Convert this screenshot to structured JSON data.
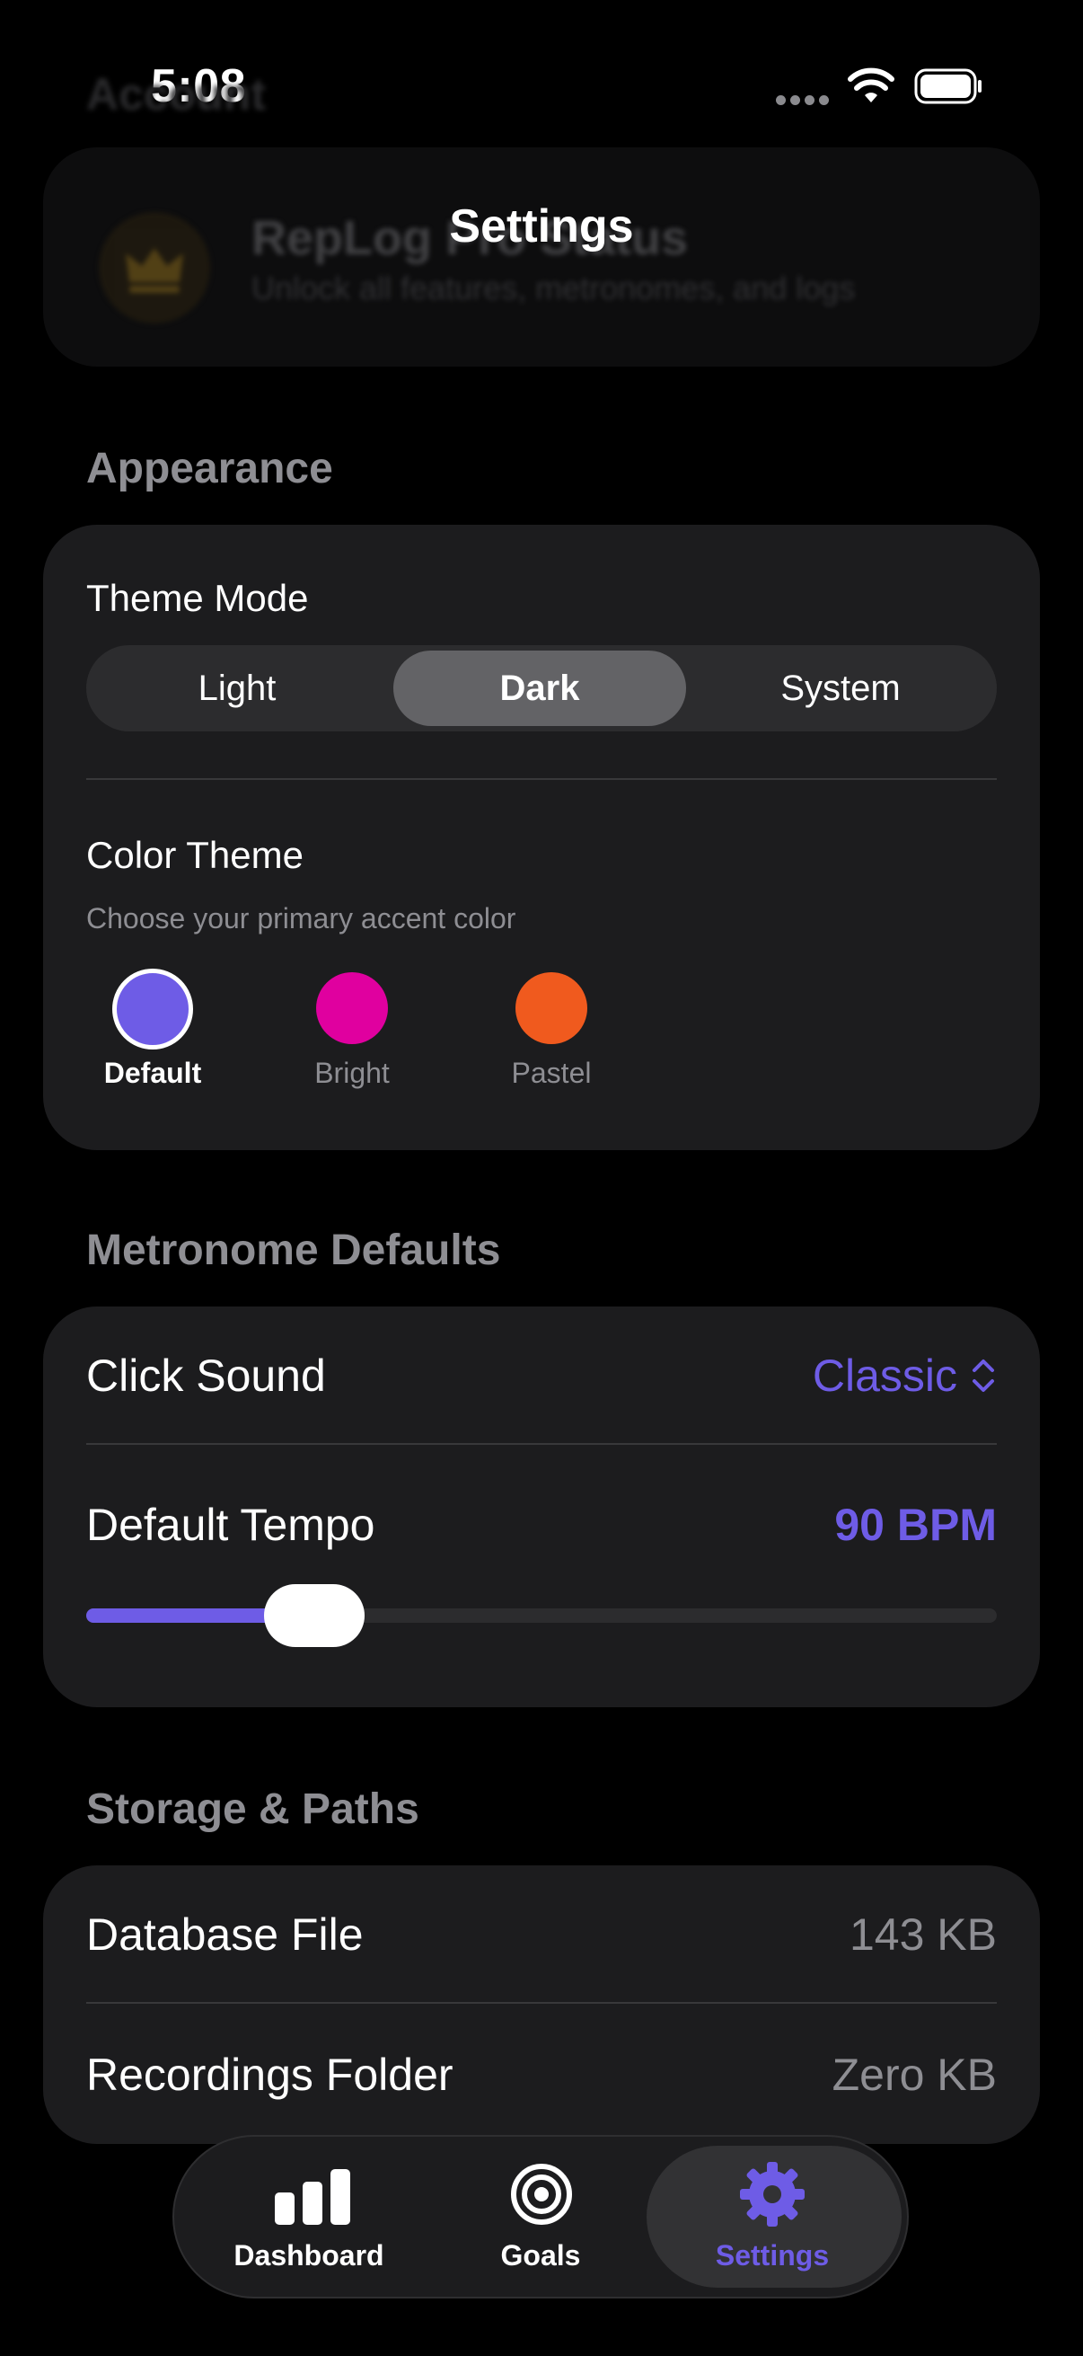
{
  "status_bar": {
    "time": "5:08"
  },
  "nav": {
    "title": "Settings"
  },
  "pro_card": {
    "ghost_header": "Account",
    "title": "RepLog Pro Status",
    "subtitle": "Unlock all features, metronomes, and logs"
  },
  "appearance": {
    "header": "Appearance",
    "theme_mode_label": "Theme Mode",
    "theme_modes": [
      "Light",
      "Dark",
      "System"
    ],
    "selected_mode": "Dark",
    "color_theme_label": "Color Theme",
    "color_theme_subtitle": "Choose your primary accent color",
    "swatches": [
      {
        "label": "Default",
        "color": "#6e5ce6",
        "selected": true
      },
      {
        "label": "Bright",
        "color": "#e0009f",
        "selected": false
      },
      {
        "label": "Pastel",
        "color": "#f05a1e",
        "selected": false
      }
    ]
  },
  "metronome": {
    "header": "Metronome Defaults",
    "click_sound_label": "Click Sound",
    "click_sound_value": "Classic",
    "tempo_label": "Default Tempo",
    "tempo_value": "90 BPM",
    "tempo_slider_fraction": 0.25
  },
  "storage": {
    "header": "Storage & Paths",
    "database_label": "Database File",
    "database_value": "143 KB",
    "recordings_label": "Recordings Folder",
    "recordings_value": "Zero KB"
  },
  "tabbar": {
    "tabs": [
      {
        "label": "Dashboard",
        "icon": "bar-chart-icon"
      },
      {
        "label": "Goals",
        "icon": "target-icon"
      },
      {
        "label": "Settings",
        "icon": "gear-icon"
      }
    ],
    "selected": "Settings"
  },
  "colors": {
    "accent": "#6e5ce6",
    "background": "#000000",
    "card": "#1c1c1e"
  }
}
